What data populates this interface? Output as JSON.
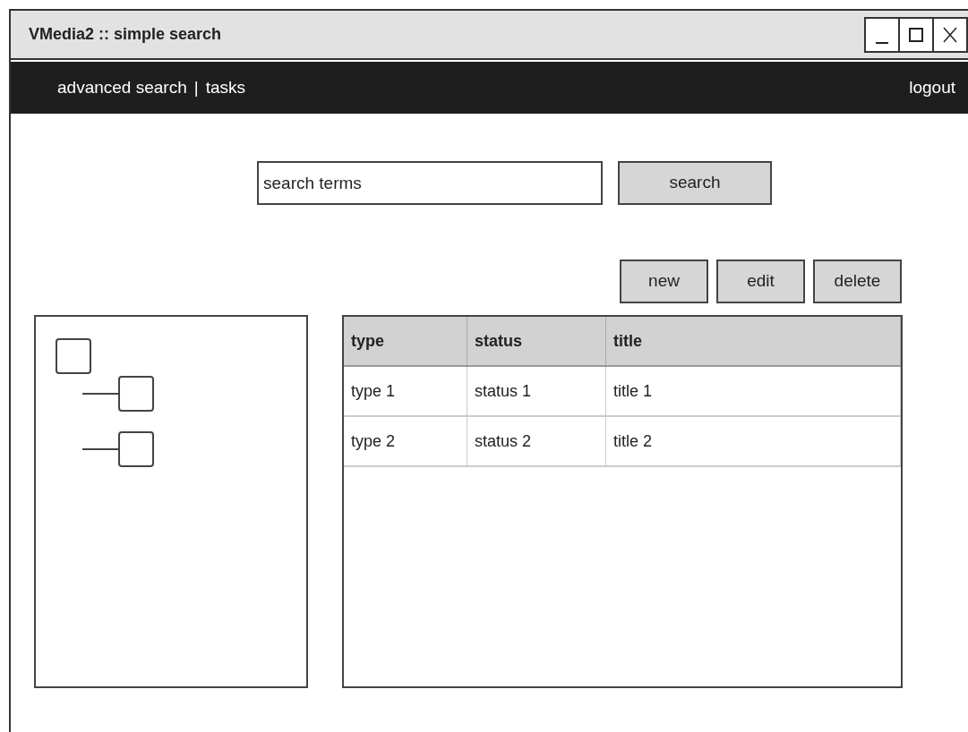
{
  "window": {
    "title": "VMedia2 :: simple search",
    "controls": [
      {
        "kind": "minimize"
      },
      {
        "kind": "maximize"
      },
      {
        "kind": "close"
      }
    ]
  },
  "nav": {
    "links": [
      "advanced search",
      "tasks"
    ],
    "separator": "|",
    "logout": "logout"
  },
  "search": {
    "placeholder": "search terms",
    "button": "search"
  },
  "actions": [
    "new",
    "edit",
    "delete"
  ],
  "tree": {
    "nodes": [
      {
        "kind": "node",
        "children": [
          {
            "kind": "node"
          },
          {
            "kind": "node"
          }
        ]
      }
    ]
  },
  "table": {
    "columns": [
      "type",
      "status",
      "title"
    ],
    "rows": [
      [
        "type 1",
        "status 1",
        "title 1"
      ],
      [
        "type 2",
        "status 2",
        "title 2"
      ]
    ]
  }
}
